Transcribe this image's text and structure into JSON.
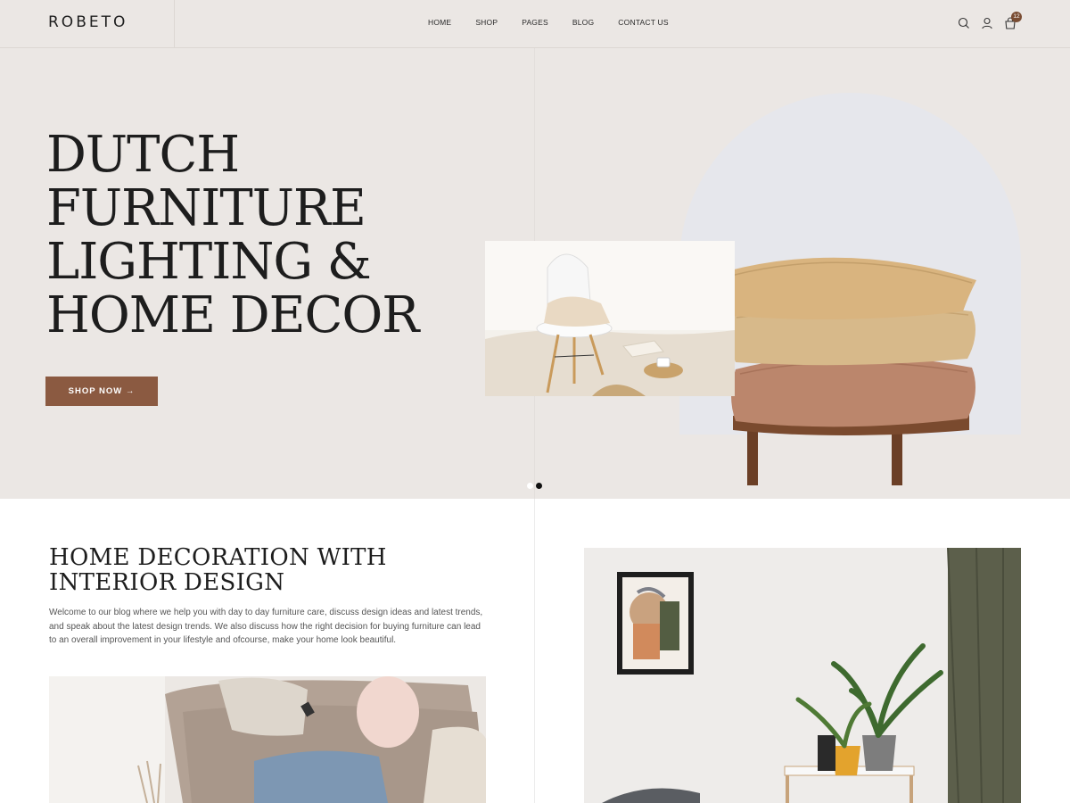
{
  "header": {
    "logo": "ROBETO",
    "nav": [
      "HOME",
      "SHOP",
      "PAGES",
      "BLOG",
      "CONTACT US"
    ],
    "cart_count": "12",
    "icons": [
      "search-icon",
      "user-icon",
      "cart-icon"
    ]
  },
  "hero": {
    "title_lines": [
      "DUTCH",
      "FURNITURE",
      "LIGHTING &",
      "HOME DECOR"
    ],
    "button_label": "SHOP NOW →",
    "slides": 2,
    "active_slide": 2
  },
  "about": {
    "title_lines": [
      "HOME DECORATION WITH",
      "INTERIOR DESIGN"
    ],
    "body": "Welcome to our blog where we help you with day to day furniture care, discuss design ideas and latest trends, and speak about the latest design trends. We also discuss how the right decision for buying furniture can lead to an overall improvement in your lifestyle and ofcourse, make your home look beautiful."
  },
  "colors": {
    "hero_bg": "#ebe7e4",
    "accent": "#8b5a41",
    "text_dark": "#1d1d1d"
  }
}
